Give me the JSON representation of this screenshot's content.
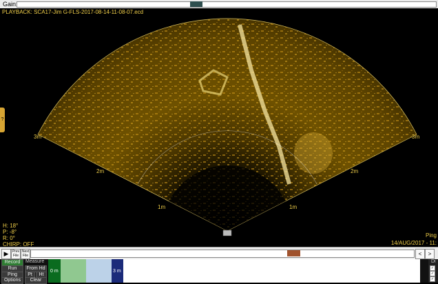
{
  "gain": {
    "label": "Gain:"
  },
  "viewer": {
    "title": "PLAYBACK: SCA17-Jim G-FLS-2017-08-14-11-08-07.ecd",
    "side_tab": "?",
    "range_labels": {
      "left_3m": "3m",
      "left_2m": "2m",
      "left_1m": "1m",
      "right_1m": "1m",
      "right_2m": "2m",
      "right_3m": "3m"
    },
    "stats": {
      "heading": "H: 18°",
      "pitch": "P: -8°",
      "roll": "R: 0°",
      "chirp": "CHIRP: OFF"
    },
    "ping_label": "Ping",
    "datetime": "14/AUG/2017 - 11:"
  },
  "playbar": {
    "play_label": "▶",
    "prev_file": "Prev File",
    "next_file": "Next File",
    "left_arrow": "<",
    "right_arrow": ">",
    "position_fraction": 0.76
  },
  "controls": {
    "left_buttons": [
      "Record",
      "Run",
      "Ping",
      "Options"
    ],
    "measure_title": "Measure",
    "measure_buttons": [
      "From Hd",
      "Pt",
      "Ht",
      "Clear"
    ],
    "ruler_labels": [
      "0 m",
      "3 m"
    ],
    "right_title": "Di",
    "checks": [
      "✓",
      "✓",
      "✓"
    ],
    "colors": {
      "record": "#2e7d32",
      "seg_green": "#0a6b1f",
      "seg_lightgreen": "#90c890",
      "seg_lightblue": "#bcd2e8",
      "seg_navy": "#1b2b7a"
    }
  }
}
